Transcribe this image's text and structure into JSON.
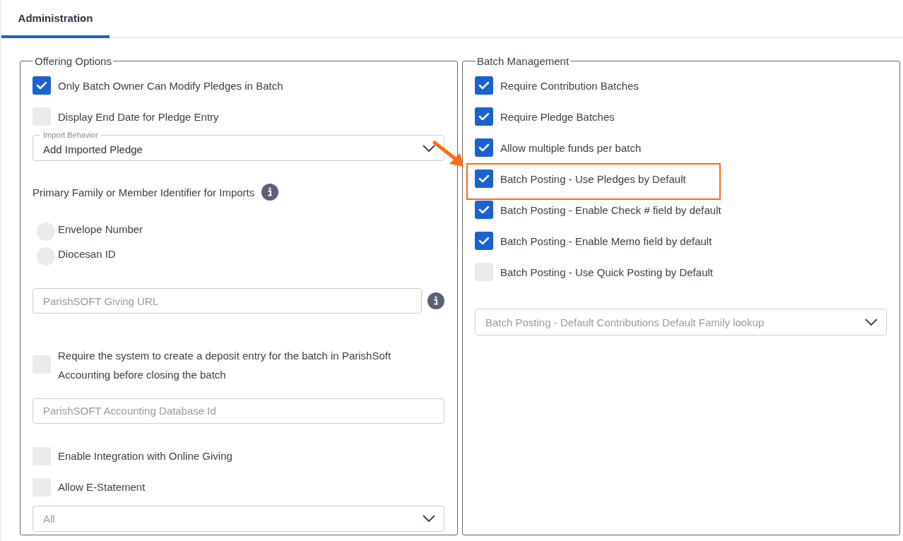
{
  "tabs": [
    {
      "label": "Administration",
      "selected": true
    }
  ],
  "panels": [
    {
      "title": "Offering Options",
      "items": [
        {
          "kind": "checkbox",
          "label": "Only Batch Owner Can Modify Pledges in Batch",
          "checked": true
        },
        {
          "kind": "checkbox",
          "label": "Display End Date for Pledge Entry",
          "checked": false
        },
        {
          "kind": "select",
          "label": "Import Behavior",
          "value": "Add Imported Pledge"
        },
        {
          "kind": "heading",
          "label": "Primary Family or Member Identifier for Imports"
        },
        {
          "kind": "radio",
          "label": "Envelope Number",
          "selected": false
        },
        {
          "kind": "radio",
          "label": "Diocesan ID",
          "selected": false
        },
        {
          "kind": "input",
          "placeholder": "ParishSOFT Giving URL",
          "info": true
        },
        {
          "kind": "checkbox",
          "label": "Require the system to create a deposit entry for the batch in ParishSoft Accounting before closing the batch",
          "checked": false
        },
        {
          "kind": "input",
          "placeholder": "ParishSOFT Accounting Database Id",
          "info": false
        },
        {
          "kind": "checkbox",
          "label": "Enable Integration with Online Giving",
          "checked": false
        },
        {
          "kind": "checkbox",
          "label": "Allow E-Statement",
          "checked": false
        },
        {
          "kind": "select",
          "placeholder": "All"
        }
      ]
    },
    {
      "title": "Batch Management",
      "items": [
        {
          "kind": "checkbox",
          "label": "Require Contribution Batches",
          "checked": true
        },
        {
          "kind": "checkbox",
          "label": "Require Pledge Batches",
          "checked": true
        },
        {
          "kind": "checkbox",
          "label": "Allow multiple funds per batch",
          "checked": true
        },
        {
          "kind": "checkbox",
          "label": "Batch Posting - Use Pledges by Default",
          "checked": true,
          "highlighted": true
        },
        {
          "kind": "checkbox",
          "label": "Batch Posting - Enable Check # field by default",
          "checked": true
        },
        {
          "kind": "checkbox",
          "label": "Batch Posting - Enable Memo field by default",
          "checked": true
        },
        {
          "kind": "checkbox",
          "label": "Batch Posting - Use Quick Posting by Default",
          "checked": false
        },
        {
          "kind": "select",
          "placeholder": "Batch Posting - Default Contributions Default Family lookup"
        }
      ]
    }
  ]
}
